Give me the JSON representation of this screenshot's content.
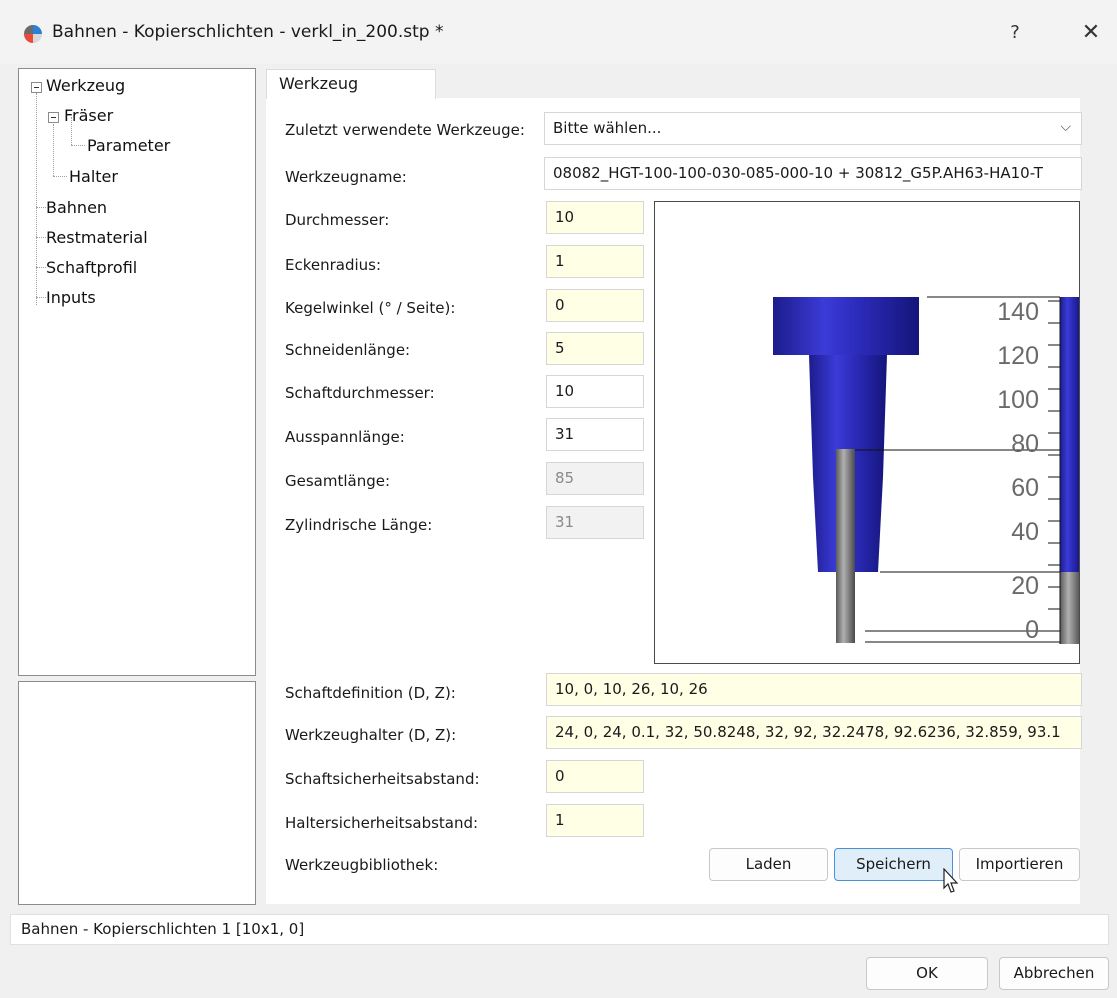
{
  "window": {
    "title": "Bahnen - Kopierschlichten - verkl_in_200.stp *",
    "help_label": "?",
    "close_label": "✕"
  },
  "tree": {
    "items": [
      {
        "label": "Werkzeug"
      },
      {
        "label": "Fräser"
      },
      {
        "label": "Parameter"
      },
      {
        "label": "Halter"
      },
      {
        "label": "Bahnen"
      },
      {
        "label": "Restmaterial"
      },
      {
        "label": "Schaftprofil"
      },
      {
        "label": "Inputs"
      }
    ]
  },
  "tab": {
    "label": "Werkzeug"
  },
  "form": {
    "recent_tools": {
      "label": "Zuletzt verwendete Werkzeuge:",
      "value": "Bitte wählen..."
    },
    "tool_name": {
      "label": "Werkzeugname:",
      "value": "08082_HGT-100-100-030-085-000-10 + 30812_G5P.AH63-HA10-T"
    },
    "diameter": {
      "label": "Durchmesser:",
      "value": "10"
    },
    "corner_radius": {
      "label": "Eckenradius:",
      "value": "1"
    },
    "cone_angle": {
      "label": "Kegelwinkel (° / Seite):",
      "value": "0"
    },
    "cutting_length": {
      "label": "Schneidenlänge:",
      "value": "5"
    },
    "shank_diameter": {
      "label": "Schaftdurchmesser:",
      "value": "10"
    },
    "stickout_length": {
      "label": "Ausspannlänge:",
      "value": "31"
    },
    "total_length": {
      "label": "Gesamtlänge:",
      "value": "85"
    },
    "cyl_length": {
      "label": "Zylindrische Länge:",
      "value": "31"
    },
    "shank_def": {
      "label": "Schaftdefinition (D, Z):",
      "value": "10, 0, 10, 26, 10, 26"
    },
    "holder_def": {
      "label": "Werkzeughalter (D, Z):",
      "value": "24, 0, 24, 0.1, 32, 50.8248, 32, 92, 32.2478, 92.6236, 32.859, 93.1"
    },
    "shank_safety": {
      "label": "Schaftsicherheitsabstand:",
      "value": "0"
    },
    "holder_safety": {
      "label": "Haltersicherheitsabstand:",
      "value": "1"
    },
    "library": {
      "label": "Werkzeugbibliothek:"
    }
  },
  "buttons": {
    "load": "Laden",
    "save": "Speichern",
    "import": "Importieren",
    "ok": "OK",
    "cancel": "Abbrechen"
  },
  "ruler": {
    "ticks": [
      "140",
      "120",
      "100",
      "80",
      "60",
      "40",
      "20",
      "0"
    ]
  },
  "status": {
    "text": "Bahnen - Kopierschlichten 1 [10x1, 0]"
  },
  "colors": {
    "tool_blue": "#2222b0",
    "shank_gray": "#8a8a8a",
    "field_yellow": "#ffffe6",
    "button_hover": "#e0eef9"
  }
}
